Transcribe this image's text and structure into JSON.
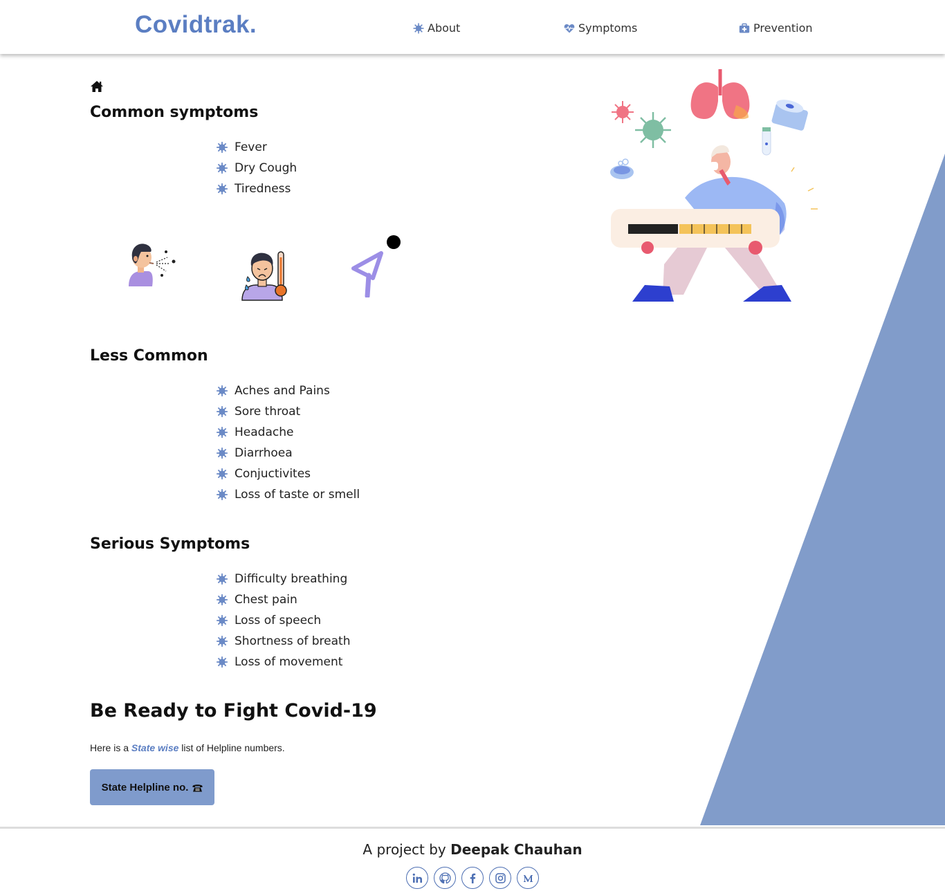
{
  "nav": {
    "brand": "Covidtrak.",
    "items": [
      {
        "label": "About",
        "icon": "virus-icon"
      },
      {
        "label": "Symptoms",
        "icon": "heartbeat-icon"
      },
      {
        "label": "Prevention",
        "icon": "medkit-icon"
      }
    ]
  },
  "colors": {
    "accent": "#5b7ec2",
    "triangle": "#819cca",
    "button": "#7f9bcc"
  },
  "sections": {
    "common": {
      "title": "Common symptoms",
      "items": [
        "Fever",
        "Dry Cough",
        "Tiredness"
      ]
    },
    "less": {
      "title": "Less Common",
      "items": [
        "Aches and Pains",
        "Sore throat",
        "Headache",
        "Diarrhoea",
        "Conjuctivites",
        "Loss of taste or smell"
      ]
    },
    "serious": {
      "title": "Serious Symptoms",
      "items": [
        "Difficulty breathing",
        "Chest pain",
        "Loss of speech",
        "Shortness of breath",
        "Loss of movement"
      ]
    }
  },
  "fight": {
    "title": "Be Ready to Fight Covid-19",
    "text_before": "Here is a ",
    "text_em": "State wise",
    "text_after": " list of Helpline numbers.",
    "button_label": "State Helpline no."
  },
  "footer": {
    "credit_prefix": "A project by ",
    "credit_name": "Deepak Chauhan",
    "socials": [
      "linkedin-icon",
      "github-icon",
      "facebook-icon",
      "instagram-icon",
      "medium-icon"
    ]
  }
}
